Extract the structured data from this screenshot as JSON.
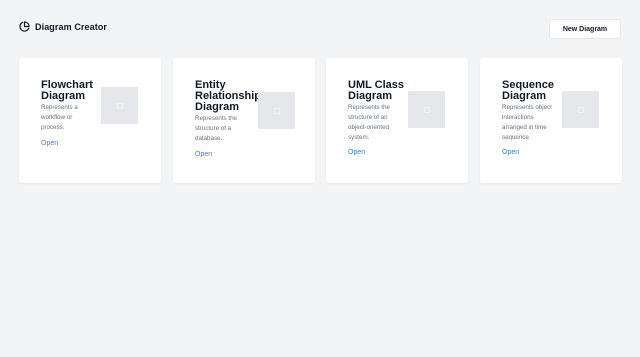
{
  "header": {
    "app_title": "Diagram Creator",
    "logo_icon": "pie-chart-icon",
    "new_button_label": "New Diagram"
  },
  "cards": [
    {
      "title": "Flowchart Diagram",
      "description": "Represents a workflow or process.",
      "link_label": "Open",
      "thumbnail_icon": "image-placeholder-icon"
    },
    {
      "title": "Entity Relationship Diagram",
      "description": "Represents the structure of a database.",
      "link_label": "Open",
      "thumbnail_icon": "image-placeholder-icon"
    },
    {
      "title": "UML Class Diagram",
      "description": "Represents the structure of an object-oriented system.",
      "link_label": "Open",
      "thumbnail_icon": "image-placeholder-icon"
    },
    {
      "title": "Sequence Diagram",
      "description": "Represents object interactions arranged in time sequence.",
      "link_label": "Open",
      "thumbnail_icon": "image-placeholder-icon"
    }
  ],
  "colors": {
    "background": "#f3f4f6",
    "card": "#ffffff",
    "link": "#3b82f6",
    "muted_text": "#6b7280",
    "placeholder": "#e5e7eb"
  }
}
